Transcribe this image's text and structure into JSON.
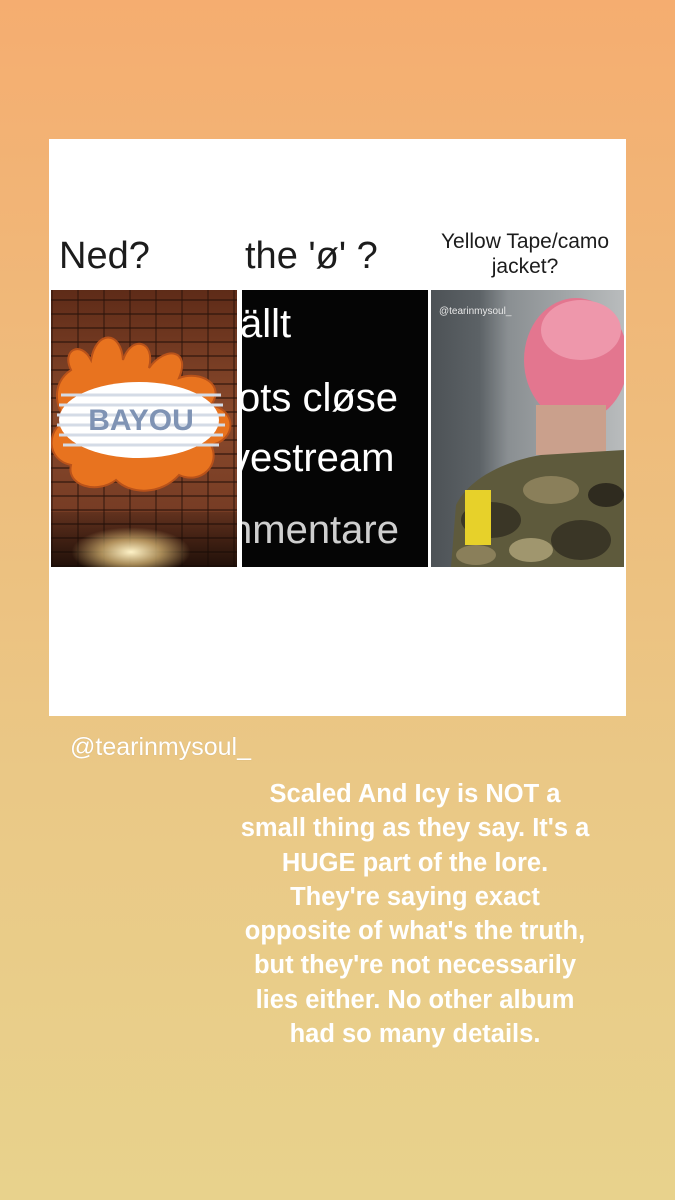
{
  "story": {
    "card": {
      "labels": {
        "ned": "Ned?",
        "o_symbol": "the 'ø' ?",
        "yellow_tape": "Yellow Tape/camo jacket?"
      },
      "sign_text": "BAYOU",
      "text_panel_lines": [
        "ällt",
        "ots cløse",
        "vestream",
        "nmentare"
      ],
      "watermark": "@tearinmysoul_"
    },
    "username": "@tearinmysoul_",
    "caption": "Scaled And Icy is NOT a\nsmall thing as they say. It's a\nHUGE part of the lore.\nThey're saying exact\nopposite of what's the truth,\nbut they're not necessarily\nlies either. No other album\nhad so many details."
  },
  "colors": {
    "background_top": "#f5ad70",
    "background_bottom": "#e8d28c",
    "sign_orange": "#e8731f",
    "sign_stripe_blue": "#7f93b4",
    "tape_yellow": "#e7d12a",
    "hair_pink": "#e3768f"
  }
}
